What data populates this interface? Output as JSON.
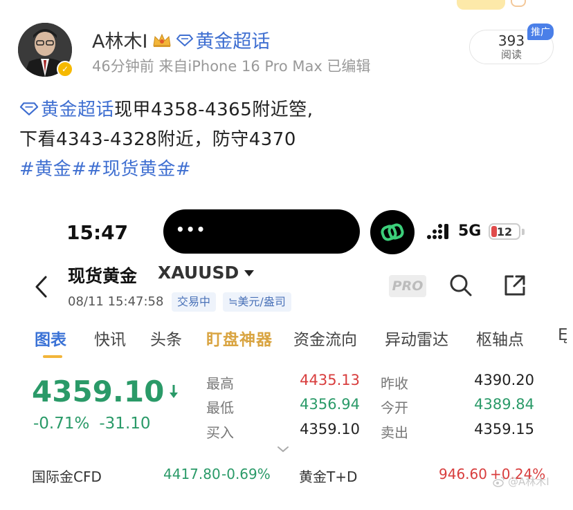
{
  "post": {
    "author_name": "A林木I",
    "topic_tag": "黄金超话",
    "meta": "46分钟前  来自iPhone 16 Pro Max  已编辑",
    "read_count": "393",
    "read_label": "阅读",
    "promo_tag": "推广",
    "body_topic": "黄金超话",
    "body_line1_rest": " 现甲4358-4365附近箜,",
    "body_line2": "下看4343-4328附近，防守4370",
    "body_line3": "#黄金##现货黄金#"
  },
  "screenshot": {
    "status_bar": {
      "time": "15:47",
      "network": "5G",
      "battery": "12",
      "island_dots": "•••"
    },
    "instrument": {
      "name": "现货黄金",
      "code": "XAUUSD",
      "datetime": "08/11 15:47:58",
      "status_chip": "交易中",
      "unit_chip": "≒美元/盎司",
      "pro_label": "PRO"
    },
    "tabs": [
      "图表",
      "快讯",
      "头条",
      "盯盘神器",
      "资金流向",
      "异动雷达",
      "枢轴点",
      "Ę"
    ],
    "quote": {
      "price": "4359.10",
      "change_pct": "-0.71%",
      "change_abs": "-31.10",
      "high_label": "最高",
      "high": "4435.13",
      "low_label": "最低",
      "low": "4356.94",
      "bid_label": "买入",
      "bid": "4359.10",
      "prev_close_label": "昨收",
      "prev_close": "4390.20",
      "open_label": "今开",
      "open": "4389.84",
      "ask_label": "卖出",
      "ask": "4359.15"
    },
    "related": {
      "item1_name": "国际金CFD",
      "item1_price": "4417.80",
      "item1_change": "-0.69%",
      "item2_name": "黄金T+D",
      "item2_price": "946.60",
      "item2_change": "+0.24%"
    },
    "watermark": "@A林木I"
  },
  "colors": {
    "link_blue": "#3f6fd1",
    "up_red": "#d83d3d",
    "down_green": "#2a9a68",
    "tab_active": "#3a72d6",
    "tab_special": "#d9a441"
  }
}
